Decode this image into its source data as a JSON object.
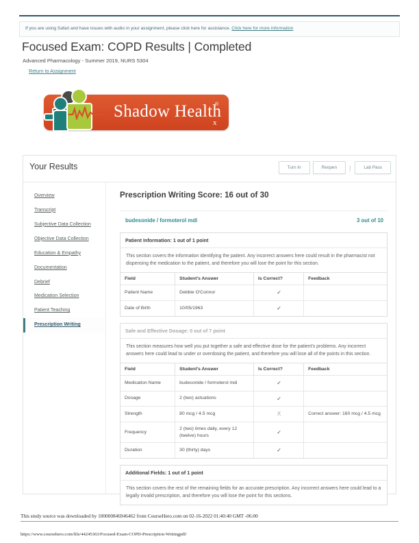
{
  "notice": {
    "text": "If you are using Safari and have issues with audio in your assignment, please click here for assistance. ",
    "link_text": "Click here for more information"
  },
  "header": {
    "title": "Focused Exam: COPD Results | Completed",
    "subtitle": "Advanced Pharmacology - Summer 2019, NURS 5304",
    "return_link": "Return to Assignment"
  },
  "logo": {
    "brand": "Shadow Health",
    "registered": "®",
    "subscript": "x"
  },
  "results": {
    "heading": "Your Results",
    "buttons": {
      "turn_in": "Turn In",
      "reopen": "Reopen",
      "separator": "|",
      "lab_pass": "Lab Pass"
    }
  },
  "sidebar": {
    "items": [
      {
        "label": "Overview",
        "active": false
      },
      {
        "label": "Transcript",
        "active": false
      },
      {
        "label": "Subjective Data Collection",
        "active": false
      },
      {
        "label": "Objective Data Collection",
        "active": false
      },
      {
        "label": "Education & Empathy",
        "active": false
      },
      {
        "label": "Documentation",
        "active": false
      },
      {
        "label": "Debrief",
        "active": false
      },
      {
        "label": "Medication Selection",
        "active": false
      },
      {
        "label": "Patient Teaching",
        "active": false
      },
      {
        "label": "Prescription Writing",
        "active": true
      }
    ]
  },
  "main": {
    "score_heading": "Prescription Writing Score: 16 out of 30",
    "drug": {
      "name": "budesonide / formoterol mdi",
      "score": "3 out of 10"
    },
    "table_headers": {
      "field": "Field",
      "answer": "Student's Answer",
      "correct": "Is Correct?",
      "feedback": "Feedback"
    },
    "marks": {
      "check": "✓",
      "cross": "X"
    },
    "sections": [
      {
        "title": "Patient Information: 1 out of 1 point",
        "muted": false,
        "description": "This section covers the information identifying the patient. Any incorrect answers here could result in the pharmacist not dispensing the medication to the patient, and therefore you will lose the point for this section.",
        "rows": [
          {
            "field": "Patient Name",
            "answer": "Debbie O'Connor",
            "correct": "check",
            "feedback": ""
          },
          {
            "field": "Date of Birth",
            "answer": "10/05/1963",
            "correct": "check",
            "feedback": ""
          }
        ]
      },
      {
        "title": "Safe and Effective Dosage: 0 out of 7 point",
        "muted": true,
        "description": "This section measures how well you put together a safe and effective dose for the patient's problems. Any incorrect answers here could lead to under or overdosing the patient, and therefore you will lose all of the points in this section.",
        "rows": [
          {
            "field": "Medication Name",
            "answer": "budesonide / formoterol mdi",
            "correct": "check",
            "feedback": ""
          },
          {
            "field": "Dosage",
            "answer": "2 (two) actuations",
            "correct": "check",
            "feedback": ""
          },
          {
            "field": "Strength",
            "answer": "80 mcg / 4.5 mcg",
            "correct": "cross",
            "feedback": "Correct answer: 160 mcg / 4.5 mcg"
          },
          {
            "field": "Frequency",
            "answer": "2 (two) times daily, every 12 (twelve) hours",
            "correct": "check",
            "feedback": ""
          },
          {
            "field": "Duration",
            "answer": "30 (thirty) days",
            "correct": "check",
            "feedback": ""
          }
        ]
      },
      {
        "title": "Additional Fields: 1 out of 1 point",
        "muted": false,
        "description": "This section covers the rest of the remaining fields for an accurate prescription. Any incorrect answers here could lead to a legally invalid prescription, and therefore you will lose the point for this sections.",
        "rows": []
      }
    ]
  },
  "footer": {
    "watermark": "This study source was downloaded by 100000846946462 from CourseHero.com on 02-16-2022 01:40:40 GMT -06:00",
    "url": "https://www.coursehero.com/file/44245363/Focused-Exam-COPD-Prescription-Writingpdf/"
  }
}
